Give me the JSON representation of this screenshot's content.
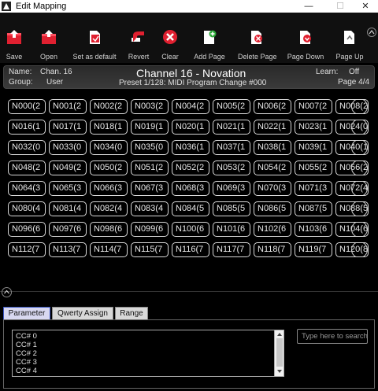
{
  "window": {
    "title": "Edit Mapping",
    "minimize": "—",
    "maximize": "☐",
    "close": "✕"
  },
  "toolbar": {
    "save": "Save",
    "open": "Open",
    "set_default": "Set as default",
    "revert": "Revert",
    "clear": "Clear",
    "add_page": "Add Page",
    "delete_page": "Delete Page",
    "page_down": "Page Down",
    "page_up": "Page Up"
  },
  "info": {
    "name_label": "Name:",
    "name_value": "Chan. 16",
    "group_label": "Group:",
    "group_value": "User",
    "title": "Channel 16 - Novation",
    "preset": "Preset 1/128: MIDI Program Change #000",
    "learn_label": "Learn:",
    "learn_value": "Off",
    "page": "Page 4/4"
  },
  "grid": [
    [
      "N000(2",
      "N001(2",
      "N002(2",
      "N003(2",
      "N004(2",
      "N005(2",
      "N006(2",
      "N007(2",
      "N008(2"
    ],
    [
      "N016(1",
      "N017(1",
      "N018(1",
      "N019(1",
      "N020(1",
      "N021(1",
      "N022(1",
      "N023(1",
      "N024(0"
    ],
    [
      "N032(0",
      "N033(0",
      "N034(0",
      "N035(0",
      "N036(1",
      "N037(1",
      "N038(1",
      "N039(1",
      "N040(1"
    ],
    [
      "N048(2",
      "N049(2",
      "N050(2",
      "N051(2",
      "N052(2",
      "N053(2",
      "N054(2",
      "N055(2",
      "N056(2"
    ],
    [
      "N064(3",
      "N065(3",
      "N066(3",
      "N067(3",
      "N068(3",
      "N069(3",
      "N070(3",
      "N071(3",
      "N072(4"
    ],
    [
      "N080(4",
      "N081(4",
      "N082(4",
      "N083(4",
      "N084(5",
      "N085(5",
      "N086(5",
      "N087(5",
      "N088(5"
    ],
    [
      "N096(6",
      "N097(6",
      "N098(6",
      "N099(6",
      "N100(6",
      "N101(6",
      "N102(6",
      "N103(6",
      "N104(6"
    ],
    [
      "N112(7",
      "N113(7",
      "N114(7",
      "N115(7",
      "N116(7",
      "N117(7",
      "N118(7",
      "N119(7",
      "N120(8"
    ]
  ],
  "tabs": [
    "Parameter",
    "Qwerty Assign",
    "Range"
  ],
  "list": [
    "CC# 0",
    "CC# 1",
    "CC# 2",
    "CC# 3",
    "CC# 4"
  ],
  "search": {
    "placeholder": "Type here to search"
  },
  "colors": {
    "save_red": "#e02030",
    "open_red": "#e02030",
    "clear_red": "#e02030",
    "tab_active": "#3a55c0"
  }
}
